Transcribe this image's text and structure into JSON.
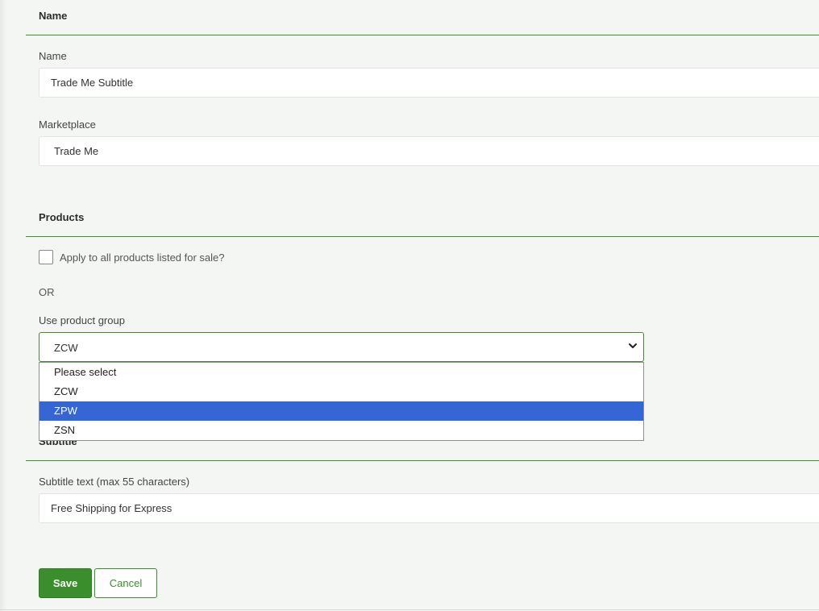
{
  "sections": {
    "name_title": "Name",
    "products_title": "Products",
    "subtitle_title": "Subtitle"
  },
  "name_field": {
    "label": "Name",
    "value": "Trade Me Subtitle"
  },
  "marketplace_field": {
    "label": "Marketplace",
    "value": "Trade Me"
  },
  "products": {
    "apply_all_label": "Apply to all products listed for sale?",
    "apply_all_checked": false,
    "or_text": "OR",
    "group_label": "Use product group",
    "group_value": "ZCW",
    "options": [
      "Please select",
      "ZCW",
      "ZPW",
      "ZSN"
    ],
    "highlighted_option": "ZPW"
  },
  "subtitle_field": {
    "label": "Subtitle text (max 55 characters)",
    "value": "Free Shipping for Express"
  },
  "actions": {
    "save_label": "Save",
    "cancel_label": "Cancel"
  },
  "colors": {
    "accent": "#3a8f2c",
    "highlight": "#3566d6",
    "background": "#f4f6f4"
  },
  "icons": {
    "select_arrow": "chevron-down-icon"
  }
}
